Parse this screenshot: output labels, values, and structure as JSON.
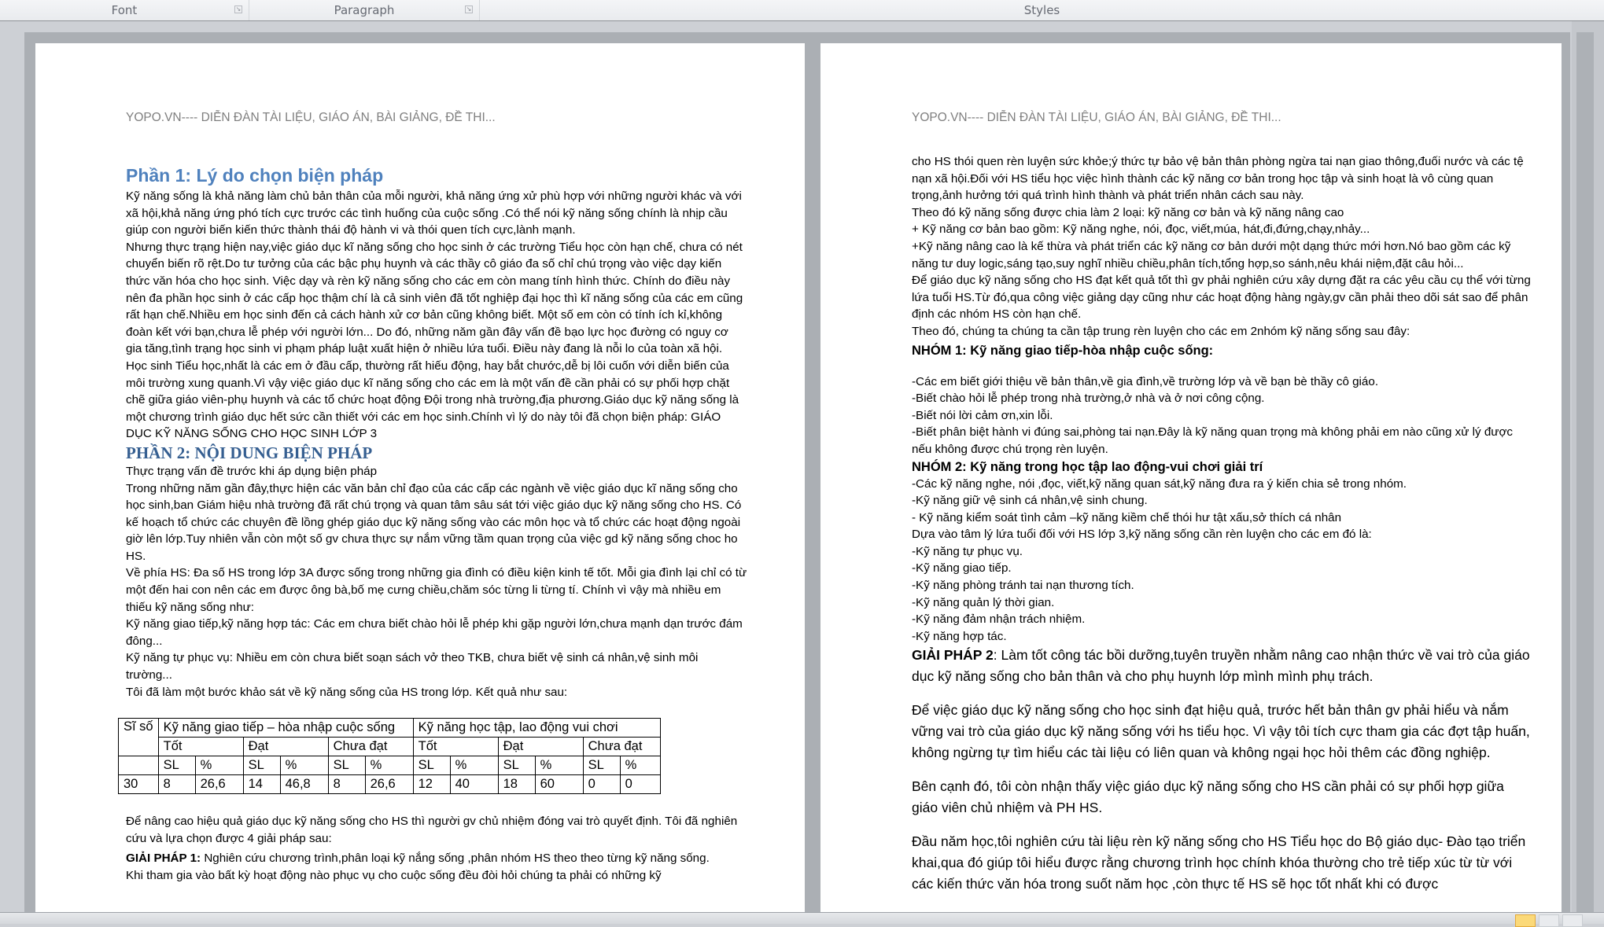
{
  "ribbon": {
    "groups": [
      {
        "label": "Font",
        "launcher_icon": "dialog-launcher-icon"
      },
      {
        "label": "Paragraph",
        "launcher_icon": "dialog-launcher-icon"
      },
      {
        "label": "Styles"
      }
    ]
  },
  "document": {
    "header_text": "YOPO.VN---- DIỄN ĐÀN TÀI LIỆU, GIÁO ÁN, BÀI GIẢNG, ĐỀ THI...",
    "page1": {
      "heading1": "Phần 1:  Lý do chọn biện pháp",
      "paragraphs_a": [
        "Kỹ năng sống là khả năng làm chủ bản thân của mỗi người, khả năng ứng xử phù hợp với những người khác và với xã hội,khả năng ứng phó tích cực trước  các tình huống của cuộc sống .Có thể nói kỹ năng sống chính là nhịp cầu giúp con người biến kiến thức thành thái độ hành vi và thói quen tích cực,lành mạnh.",
        "Nhưng thực trạng hiện nay,việc giáo dục kĩ năng sống cho học sinh ở các trường Tiểu học còn hạn chế, chưa có nét chuyển biến rõ rệt.Do tư tưởng của các bậc phụ huynh và các thầy cô giáo đa số chỉ chú trọng vào việc dạy kiến thức văn hóa cho học sinh. Việc dạy và rèn kỹ năng sống cho các em còn mang tính hình thức. Chính do điều này nên đa phần học sinh ở các cấp học thậm chí là cả sinh viên đã tốt nghiệp đại học thì kĩ năng sống của các em cũng rất hạn chế.Nhiều em học sinh đến cả cách hành xử cơ bản cũng không biết. Một số em còn có tính ích kỉ,không đoàn kết với bạn,chưa lễ phép với người lớn... Do đó, những năm gần đây vấn đề bạo lực học đường có nguy cơ gia tăng,tình trạng học sinh vi phạm pháp luật xuất hiện ở nhiều lứa tuổi. Điều này đang là nỗi lo của toàn xã hội.",
        "Học sinh Tiểu học,nhất là các em ở đầu cấp, thường rất hiếu động, hay bắt chước,dễ bị lôi cuốn với diễn biến của môi trường xung quanh.Vì vậy việc giáo dục kĩ năng sống cho các em là một vấn đề cần phải có sự phối hợp chặt chẽ giữa giáo viên-phụ huynh và các tổ chức hoạt động Đội trong nhà trường,địa phương.Giáo dục kỹ năng sống là một chương trình giáo dục hết sức cần thiết với các em học sinh.Chính vì lý do này tôi đã chọn biện pháp: GIÁO DỤC KỸ NĂNG SỐNG CHO HỌC SINH LỚP 3"
      ],
      "heading2": "PHẦN 2: NỘI DUNG BIỆN PHÁP",
      "paragraphs_b": [
        "Thực trạng vấn đề trước khi áp dụng biện pháp",
        "Trong những năm gần đây,thực hiện các văn bản chỉ đạo của các cấp các ngành về việc giáo dục kĩ năng sống cho học sinh,ban Giám hiệu nhà trường đã rất chú trọng và quan tâm sâu sát tới việc giáo dục kỹ năng sống cho HS. Có kế hoạch tổ chức các chuyên đề lồng ghép giáo dục kỹ năng sống vào các môn học và tổ chức các hoạt động ngoài giờ lên lớp.Tuy nhiên vẫn còn một số gv chưa thực sự nắm vững tầm quan trọng của việc gd kỹ năng sống choc ho HS.",
        "Về phía HS: Đa số HS trong lớp 3A được sống trong những gia đình có điều kiện kinh tế tốt. Mỗi gia đình lại chỉ có từ một đến hai con nên các em được ông bà,bố mẹ cưng chiều,chăm sóc từng li từng tí. Chính vì vậy mà nhiều em thiếu kỹ năng sống như:",
        "Kỹ năng giao tiếp,kỹ năng hợp tác: Các em chưa biết chào hỏi lễ phép khi gặp người lớn,chưa mạnh dạn trước đám đông...",
        "Kỹ năng tự phục vụ: Nhiều em còn chưa biết soạn sách vở theo TKB, chưa biết vệ sinh cá nhân,vệ sinh môi trường...",
        "Tôi đã làm một bước khảo sát về kỹ năng sống của HS trong lớp. Kết quả như sau:"
      ],
      "table": {
        "col_siso": "Sĩ số",
        "group1": "Kỹ năng giao tiếp – hòa nhập cuộc sống",
        "group2": "Kỹ năng học tập, lao động vui chơi",
        "levels": [
          "Tốt",
          "Đạt",
          "Chưa đạt",
          "Tốt",
          "Đạt",
          "Chưa đạt"
        ],
        "subheaders": [
          "SL",
          "%",
          "SL",
          "%",
          "SL",
          "%",
          "SL",
          "%",
          "SL",
          "%",
          "SL",
          "%"
        ],
        "row": [
          "30",
          "8",
          "26,6",
          "14",
          "46,8",
          "8",
          "26,6",
          "12",
          "40",
          "18",
          "60",
          "0",
          "0"
        ]
      },
      "paragraphs_c": [
        "Để nâng cao hiệu quả giáo dục kỹ năng sống cho HS thì người gv chủ nhiệm đóng vai trò quyết định. Tôi đã nghiên cứu và lựa chọn được 4 giải pháp sau:"
      ],
      "solution1_label": "GIẢI PHÁP 1:",
      "solution1_text": " Nghiên cứu chương trình,phân loại kỹ nắng sống ,phân nhóm HS theo theo từng kỹ năng sống.",
      "last_line": "Khi tham gia vào bất kỳ hoạt động nào phục vụ cho cuộc sống đều đòi hỏi chúng ta phải có những kỹ"
    },
    "page2": {
      "paragraphs_a": [
        "cho HS thói quen rèn luyện sức khỏe;ý thức tự bảo vệ bản thân phòng ngừa tai nạn giao thông,đuối nước và các tệ nạn xã hội.Đối với HS tiểu học việc hình thành các kỹ năng cơ bản trong học tập và sinh hoạt là vô cùng quan trọng,ảnh hưởng tới quá trình hình thành và phát triển nhân cách sau này.",
        " Theo đó kỹ năng sống được chia làm 2 loại: kỹ năng cơ bản và kỹ năng nâng cao",
        "+ Kỹ năng cơ bản bao gồm: Kỹ năng nghe, nói, đọc, viết,múa, hát,đi,đứng,chạy,nhảy...",
        " +Kỹ năng nâng cao là kế thừa và phát triển các kỹ năng cơ bản dưới một dạng thức mới hơn.Nó bao gồm các kỹ năng tư duy logic,sáng tạo,suy nghĩ nhiều chiều,phân tích,tổng hợp,so sánh,nêu khái niệm,đặt câu hỏi...",
        "Để giáo dục kỹ năng sống cho HS đạt kết quả tốt thì gv phải nghiên cứu xây dựng đặt ra các yêu cầu cụ thể với từng lứa tuổi HS.Từ đó,qua công việc giảng dạy cũng như các hoạt động hàng ngày,gv cần phải theo dõi sát sao để phân định các nhóm HS còn hạn chế.",
        "Theo đó, chúng ta chúng ta cần tập trung rèn luyện cho các em 2nhóm kỹ năng sống sau đây:"
      ],
      "group1_title": "NHÓM 1: Kỹ năng giao tiếp-hòa nhập cuộc sống:",
      "group1_items": [
        "-Các em biết giới thiệu về bản thân,về gia đình,về trường lớp và về bạn bè thầy cô giáo.",
        "-Biết chào hỏi lễ phép trong nhà trường,ở nhà và ở nơi công cộng.",
        "-Biết nói lời cảm ơn,xin lỗi.",
        "-Biết phân biệt hành vi đúng sai,phòng tai nạn.Đây là kỹ năng quan trọng mà không phải em nào cũng xử lý được nếu không được chú trọng rèn luyện."
      ],
      "group2_title": "NHÓM 2: Kỹ năng trong học tập lao động-vui chơi giải trí",
      "group2_items": [
        "-Các kỹ năng nghe, nói ,đọc, viết,kỹ năng quan sát,kỹ năng đưa ra ý kiến chia sẻ trong nhóm.",
        "-Kỹ năng giữ vệ sinh cá nhân,vệ sinh chung.",
        "- Kỹ năng kiểm soát tình cảm –kỹ năng kiềm chế thói hư tật xấu,sở thích cá nhân",
        "Dựa vào tâm lý lứa tuổi đối với HS lớp 3,kỹ năng sống cần rèn luyện cho các em đó là:",
        "-Kỹ năng tự phục vụ.",
        "-Kỹ năng giao tiếp.",
        "-Kỹ năng phòng tránh tai nạn thương tích.",
        "-Kỹ năng quản lý thời gian.",
        "-Kỹ năng đảm nhận trách nhiệm.",
        "-Kỹ năng hợp tác."
      ],
      "solution2_label": "GIẢI PHÁP 2",
      "solution2_text": ": Làm tốt công tác bồi dưỡng,tuyên truyền nhằm nâng cao nhận thức về vai trò của giáo dục kỹ năng sống cho bản thân và cho phụ huynh lớp mình mình phụ trách.",
      "paragraphs_b": [
        "Để việc giáo dục kỹ năng sống cho học sinh  đạt hiệu quả, trước hết bản thân gv phải hiểu và nắm vững vai trò của giáo dục kỹ năng sống với hs tiểu  học. Vì vậy tôi tích cực tham gia các đợt tập huấn, không ngừng tự tìm hiểu các tài liệu có liên quan và không ngại học hỏi thêm các đồng nghiệp.",
        "Bên cạnh đó, tôi còn nhận thấy việc giáo dục kỹ năng sống cho HS cần phải có sự phối hợp giữa giáo viên chủ nhiệm và PH HS.",
        "Đầu năm học,tôi nghiên cứu tài liệu rèn kỹ năng sống cho HS Tiểu học do Bộ giáo dục- Đào tạo triển khai,qua đó giúp tôi hiểu được rằng chương trình học chính khóa thường cho trẻ tiếp xúc từ từ với các kiến thức văn hóa trong suốt năm học ,còn thực tế HS sẽ học tốt nhất khi có được"
      ]
    }
  }
}
